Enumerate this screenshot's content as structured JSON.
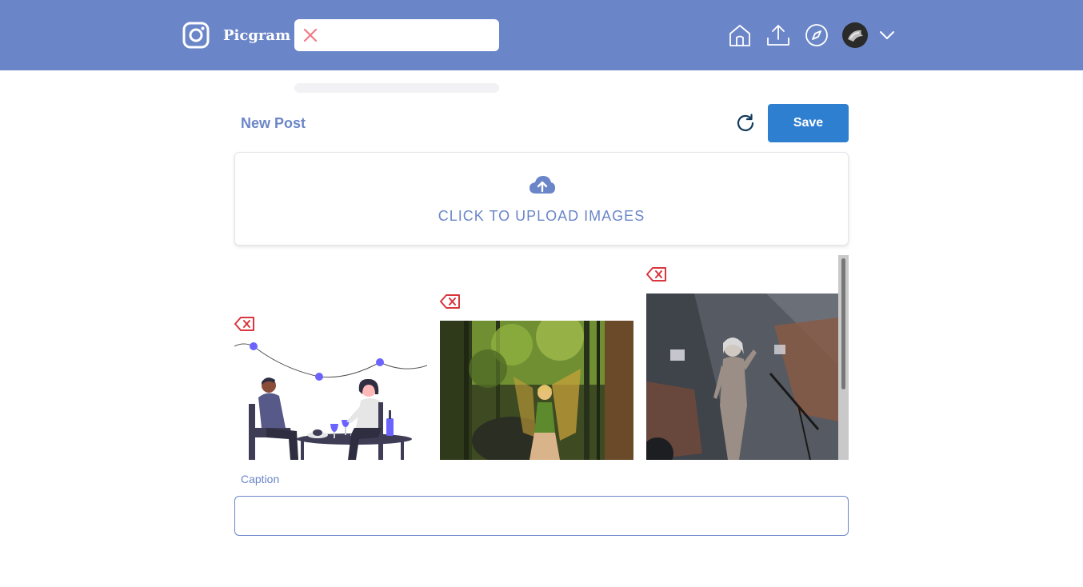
{
  "header": {
    "brand": "Picgram",
    "search": {
      "value": "",
      "placeholder": ""
    },
    "nav_icons": [
      "home-icon",
      "upload-icon",
      "explore-compass-icon"
    ],
    "menu_icon": "chevron-down-icon"
  },
  "post": {
    "title": "New Post",
    "save_label": "Save",
    "upload_label": "CLICK TO UPLOAD IMAGES",
    "caption_label": "Caption",
    "caption_value": ""
  },
  "gallery": {
    "images": [
      "couple-dinner-illustration",
      "fairy-in-forest-photo",
      "sci-fi-figure-photo"
    ]
  },
  "colors": {
    "header_bg": "#6b86c8",
    "accent": "#6b86c8",
    "button": "#2f7fd1",
    "delete": "#d9363e"
  }
}
